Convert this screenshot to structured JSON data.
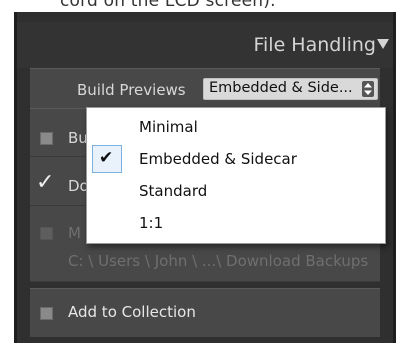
{
  "caption": "cord on the LCD screen).",
  "panel": {
    "title": "File Handling",
    "title_icon": "triangle-down-icon"
  },
  "build_previews": {
    "label": "Build Previews",
    "selected_value": "Embedded & Side...",
    "options": [
      "Minimal",
      "Embedded & Sidecar",
      "Standard",
      "1:1"
    ],
    "selected_index": 1
  },
  "rows": {
    "row1_text": "Bu",
    "row2_text": "Do",
    "row3_text": "M",
    "backup_path": "C: \\ Users \\ John \\ ...\\ Download Backups",
    "collection_text": "Add to Collection"
  },
  "colors": {
    "panel_bg": "#2f2f2f",
    "section_bg": "#484848",
    "accent_selection": "#7ab1e0"
  }
}
